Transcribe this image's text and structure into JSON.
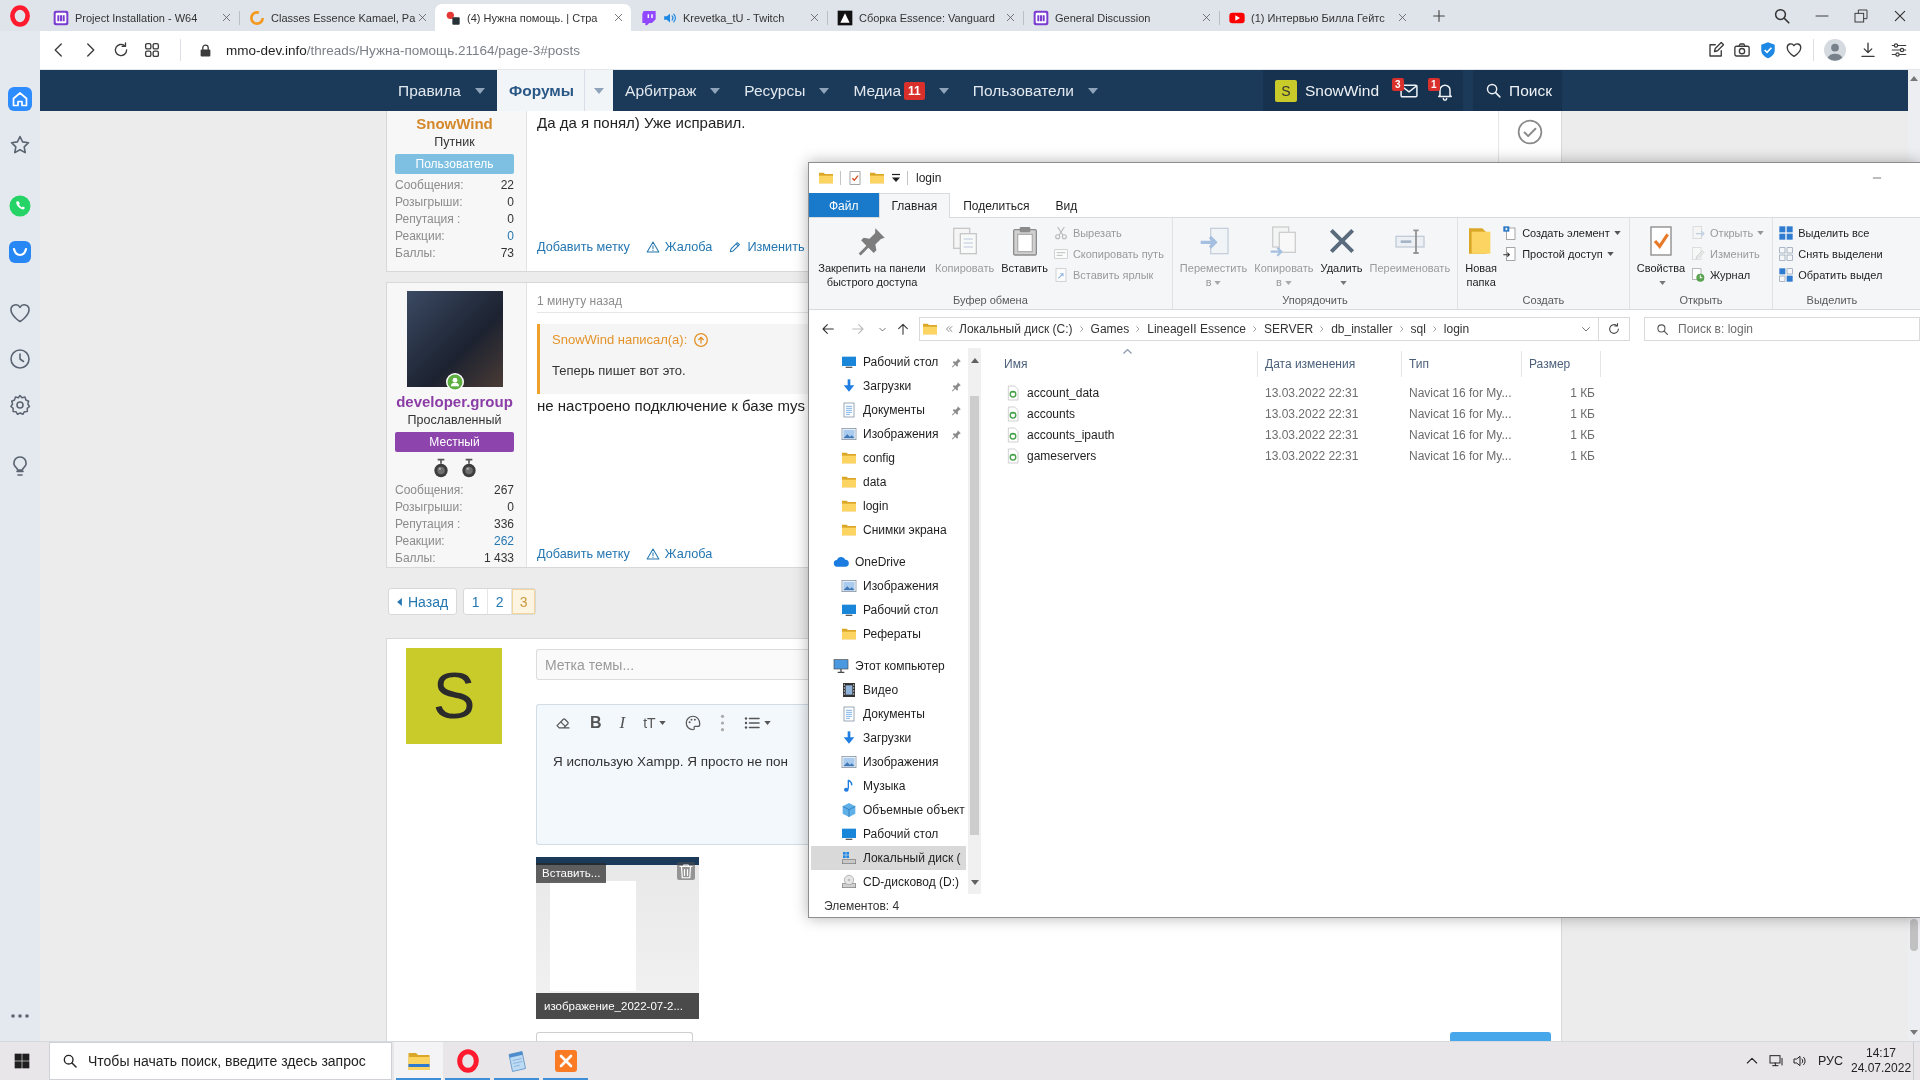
{
  "browser": {
    "tabs": [
      {
        "kind": "m-logo",
        "title": "Project Installation - W64",
        "selected": false,
        "audio": false
      },
      {
        "kind": "ring",
        "title": "Classes Essence Kamael, Pa",
        "selected": false,
        "audio": false
      },
      {
        "kind": "m-red",
        "title": "(4) Нужна помощь. | Стра",
        "selected": true,
        "audio": false
      },
      {
        "kind": "twitch",
        "title": "Krevetka_tU - Twitch",
        "selected": false,
        "audio": true
      },
      {
        "kind": "a-black",
        "title": "Сборка Essence: Vanguard",
        "selected": false,
        "audio": false
      },
      {
        "kind": "m-logo",
        "title": "General Discussion",
        "selected": false,
        "audio": false
      },
      {
        "kind": "youtube",
        "title": "(1) Интервью Билла Гейтс",
        "selected": false,
        "audio": false
      }
    ],
    "url_host": "mmo-dev.info",
    "url_path": "/threads/Нужна-помощь.21164/page-3#posts"
  },
  "sidebar": {
    "items": [
      {
        "kind": "home",
        "selected": true
      },
      {
        "kind": "star",
        "selected": false
      },
      {
        "kind": "whatsapp",
        "selected": false
      },
      {
        "kind": "vk",
        "selected": false
      },
      {
        "kind": "heart",
        "selected": false
      },
      {
        "kind": "clock",
        "selected": false
      },
      {
        "kind": "gear",
        "selected": false
      },
      {
        "kind": "bulb",
        "selected": false
      },
      {
        "kind": "more",
        "selected": false
      }
    ]
  },
  "site_nav": {
    "items": [
      {
        "label": "Правила",
        "selected": false
      },
      {
        "label": "Форумы",
        "selected": true
      },
      {
        "label": "Арбитраж",
        "selected": false
      },
      {
        "label": "Ресурсы",
        "selected": false
      },
      {
        "label": "Медиа",
        "selected": false,
        "badge": "11"
      },
      {
        "label": "Пользователи",
        "selected": false
      }
    ],
    "user": {
      "initial": "S",
      "name": "SnowWind"
    },
    "inbox_badge": "3",
    "alerts_badge": "1",
    "search": "Поиск"
  },
  "posts": [
    {
      "author": {
        "name": "SnowWind",
        "color": "#d4882a"
      },
      "user_title": "Путник",
      "banner": {
        "label": "Пользователь",
        "color": "#7dc0e2"
      },
      "stats": [
        {
          "label": "Сообщения:",
          "value": "22",
          "link": false
        },
        {
          "label": "Розыгрыши:",
          "value": "0",
          "link": false
        },
        {
          "label": "Репутация :",
          "value": "0",
          "link": false
        },
        {
          "label": "Реакции:",
          "value": "0",
          "link": true
        },
        {
          "label": "Баллы:",
          "value": "73",
          "link": false
        }
      ],
      "text": "Да да я понял) Уже исправил.",
      "actions": [
        {
          "kind": "tag",
          "label": "Добавить метку"
        },
        {
          "kind": "report",
          "label": "Жалоба"
        },
        {
          "kind": "edit",
          "label": "Изменить"
        }
      ],
      "solution_marked": false
    },
    {
      "avatar": {
        "online": true
      },
      "author": {
        "name": "developer.group",
        "color": "#8b3da6"
      },
      "user_title": "Прославленный",
      "banner": {
        "label": "Местный",
        "color": "#8e44ad"
      },
      "awards": [
        {
          "kind": "medal"
        },
        {
          "kind": "medal"
        }
      ],
      "stats": [
        {
          "label": "Сообщения:",
          "value": "267",
          "link": false
        },
        {
          "label": "Розыгрыши:",
          "value": "0",
          "link": false
        },
        {
          "label": "Репутация :",
          "value": "336",
          "link": false
        },
        {
          "label": "Реакции:",
          "value": "262",
          "link": true
        },
        {
          "label": "Баллы:",
          "value": "1 433",
          "link": false
        }
      ],
      "time": "1 минуту назад",
      "quote": {
        "author": "SnowWind написал(а):",
        "text": "Теперь пишет вот это."
      },
      "text": "не настроено подключение к базе mys",
      "actions": [
        {
          "kind": "tag",
          "label": "Добавить метку"
        },
        {
          "kind": "report",
          "label": "Жалоба"
        }
      ]
    }
  ],
  "pagination": {
    "prev": "Назад",
    "pages": [
      {
        "label": "1",
        "selected": false
      },
      {
        "label": "2",
        "selected": false
      },
      {
        "label": "3",
        "selected": true
      }
    ]
  },
  "reply": {
    "initial": "S",
    "tag_placeholder": "Метка темы...",
    "toolbar": [
      {
        "kind": "eraser",
        "dropdown": false
      },
      {
        "kind": "bold",
        "glyph": "B",
        "dropdown": false
      },
      {
        "kind": "italic",
        "glyph": "I",
        "dropdown": false
      },
      {
        "kind": "font-size",
        "glyph": "tT",
        "dropdown": true
      },
      {
        "kind": "color",
        "dropdown": false
      },
      {
        "kind": "more",
        "dropdown": false
      },
      {
        "kind": "list",
        "dropdown": true
      }
    ],
    "editor_text": "Я использую Xampp. Я просто не пон",
    "attachment": {
      "insert_label": "Вставить...",
      "filename": "изображение_2022-07-2..."
    }
  },
  "explorer": {
    "title": "login",
    "ribbon_tabs": [
      {
        "kind": "file",
        "label": "Файл",
        "selected": false
      },
      {
        "kind": "tab",
        "label": "Главная",
        "selected": true
      },
      {
        "kind": "tab",
        "label": "Поделиться",
        "selected": false
      },
      {
        "kind": "tab",
        "label": "Вид",
        "selected": false
      }
    ],
    "ribbon_groups": [
      {
        "label": "Буфер обмена",
        "large": [
          {
            "kind": "pin",
            "label": "Закрепить на панели быстрого доступа",
            "disabled": false,
            "dropdown": false
          },
          {
            "kind": "copy",
            "label": "Копировать",
            "disabled": true,
            "dropdown": false
          },
          {
            "kind": "paste",
            "label": "Вставить",
            "disabled": false,
            "dropdown": false
          }
        ],
        "small": [
          {
            "kind": "cut",
            "label": "Вырезать",
            "disabled": true,
            "dropdown": false
          },
          {
            "kind": "copy-path",
            "label": "Скопировать путь",
            "disabled": true,
            "dropdown": false
          },
          {
            "kind": "shortcut",
            "label": "Вставить ярлык",
            "disabled": true,
            "dropdown": false
          }
        ]
      },
      {
        "label": "Упорядочить",
        "large": [
          {
            "kind": "move-to",
            "label": "Переместить в",
            "disabled": true,
            "dropdown": true
          },
          {
            "kind": "copy-to",
            "label": "Копировать в",
            "disabled": true,
            "dropdown": true
          },
          {
            "kind": "delete",
            "label": "Удалить",
            "disabled": false,
            "dropdown": true
          },
          {
            "kind": "rename",
            "label": "Переименовать",
            "disabled": true,
            "dropdown": false
          }
        ]
      },
      {
        "label": "Создать",
        "large": [
          {
            "kind": "new-folder",
            "label": "Новая папка",
            "disabled": false,
            "dropdown": false
          }
        ],
        "small": [
          {
            "kind": "new-item",
            "label": "Создать элемент",
            "disabled": false,
            "dropdown": true
          },
          {
            "kind": "easy-access",
            "label": "Простой доступ",
            "disabled": false,
            "dropdown": true
          }
        ]
      },
      {
        "label": "Открыть",
        "large": [
          {
            "kind": "properties",
            "label": "Свойства",
            "disabled": false,
            "dropdown": true
          }
        ],
        "small": [
          {
            "kind": "open",
            "label": "Открыть",
            "disabled": true,
            "dropdown": true
          },
          {
            "kind": "edit",
            "label": "Изменить",
            "disabled": true,
            "dropdown": false
          },
          {
            "kind": "history",
            "label": "Журнал",
            "disabled": false,
            "dropdown": false
          }
        ]
      },
      {
        "label": "Выделить",
        "small": [
          {
            "kind": "select-all",
            "label": "Выделить все",
            "disabled": false,
            "dropdown": false
          },
          {
            "kind": "select-none",
            "label": "Снять выделени",
            "disabled": false,
            "dropdown": false
          },
          {
            "kind": "invert",
            "label": "Обратить выдел",
            "disabled": false,
            "dropdown": false
          }
        ]
      }
    ],
    "address": {
      "crumbs": [
        "Локальный диск (C:)",
        "Games",
        "LineageII Essence",
        "SERVER",
        "db_installer",
        "sql",
        "login"
      ]
    },
    "search_placeholder": "Поиск в: login",
    "nav": {
      "quick_access": [
        {
          "kind": "desktop",
          "label": "Рабочий стол",
          "pinned": true,
          "selected": false
        },
        {
          "kind": "downloads",
          "label": "Загрузки",
          "pinned": true,
          "selected": false
        },
        {
          "kind": "documents",
          "label": "Документы",
          "pinned": true,
          "selected": false
        },
        {
          "kind": "pictures",
          "label": "Изображения",
          "pinned": true,
          "selected": false
        },
        {
          "kind": "folder",
          "label": "config",
          "pinned": false,
          "selected": false
        },
        {
          "kind": "folder",
          "label": "data",
          "pinned": false,
          "selected": false
        },
        {
          "kind": "folder",
          "label": "login",
          "pinned": false,
          "selected": false
        },
        {
          "kind": "folder",
          "label": "Снимки экрана",
          "pinned": false,
          "selected": false
        }
      ],
      "roots": [
        {
          "kind": "cloud",
          "label": "OneDrive",
          "selected": false,
          "children": [
            {
              "kind": "pictures",
              "label": "Изображения",
              "selected": false
            },
            {
              "kind": "desktop",
              "label": "Рабочий стол",
              "selected": false
            },
            {
              "kind": "folder",
              "label": "Рефераты",
              "selected": false
            }
          ]
        },
        {
          "kind": "computer",
          "label": "Этот компьютер",
          "selected": false,
          "children": [
            {
              "kind": "video",
              "label": "Видео",
              "selected": false
            },
            {
              "kind": "documents",
              "label": "Документы",
              "selected": false
            },
            {
              "kind": "downloads",
              "label": "Загрузки",
              "selected": false
            },
            {
              "kind": "pictures",
              "label": "Изображения",
              "selected": false
            },
            {
              "kind": "music",
              "label": "Музыка",
              "selected": false
            },
            {
              "kind": "objects",
              "label": "Объемные объект",
              "selected": false
            },
            {
              "kind": "desktop",
              "label": "Рабочий стол",
              "selected": false
            },
            {
              "kind": "drive",
              "label": "Локальный диск (",
              "selected": true
            },
            {
              "kind": "cdrom",
              "label": "CD-дисковод (D:)",
              "selected": false
            }
          ]
        }
      ]
    },
    "files": {
      "columns": [
        {
          "label": "Имя",
          "sorted": true
        },
        {
          "label": "Дата изменения",
          "sorted": false
        },
        {
          "label": "Тип",
          "sorted": false
        },
        {
          "label": "Размер",
          "sorted": false
        }
      ],
      "rows": [
        {
          "name": "account_data",
          "date": "13.03.2022 22:31",
          "type": "Navicat 16 for My...",
          "size": "1 КБ",
          "selected": false
        },
        {
          "name": "accounts",
          "date": "13.03.2022 22:31",
          "type": "Navicat 16 for My...",
          "size": "1 КБ",
          "selected": false
        },
        {
          "name": "accounts_ipauth",
          "date": "13.03.2022 22:31",
          "type": "Navicat 16 for My...",
          "size": "1 КБ",
          "selected": false
        },
        {
          "name": "gameservers",
          "date": "13.03.2022 22:31",
          "type": "Navicat 16 for My...",
          "size": "1 КБ",
          "selected": false
        }
      ]
    },
    "status": "Элементов: 4"
  },
  "taskbar": {
    "search_placeholder": "Чтобы начать поиск, введите здесь запрос",
    "apps": [
      {
        "kind": "explorer",
        "running": true,
        "selected": true
      },
      {
        "kind": "opera",
        "running": true,
        "selected": false
      },
      {
        "kind": "app",
        "running": true,
        "selected": false
      },
      {
        "kind": "xampp",
        "running": true,
        "selected": false
      }
    ],
    "language": "РУС",
    "time": "14:17",
    "date": "24.07.2022"
  }
}
